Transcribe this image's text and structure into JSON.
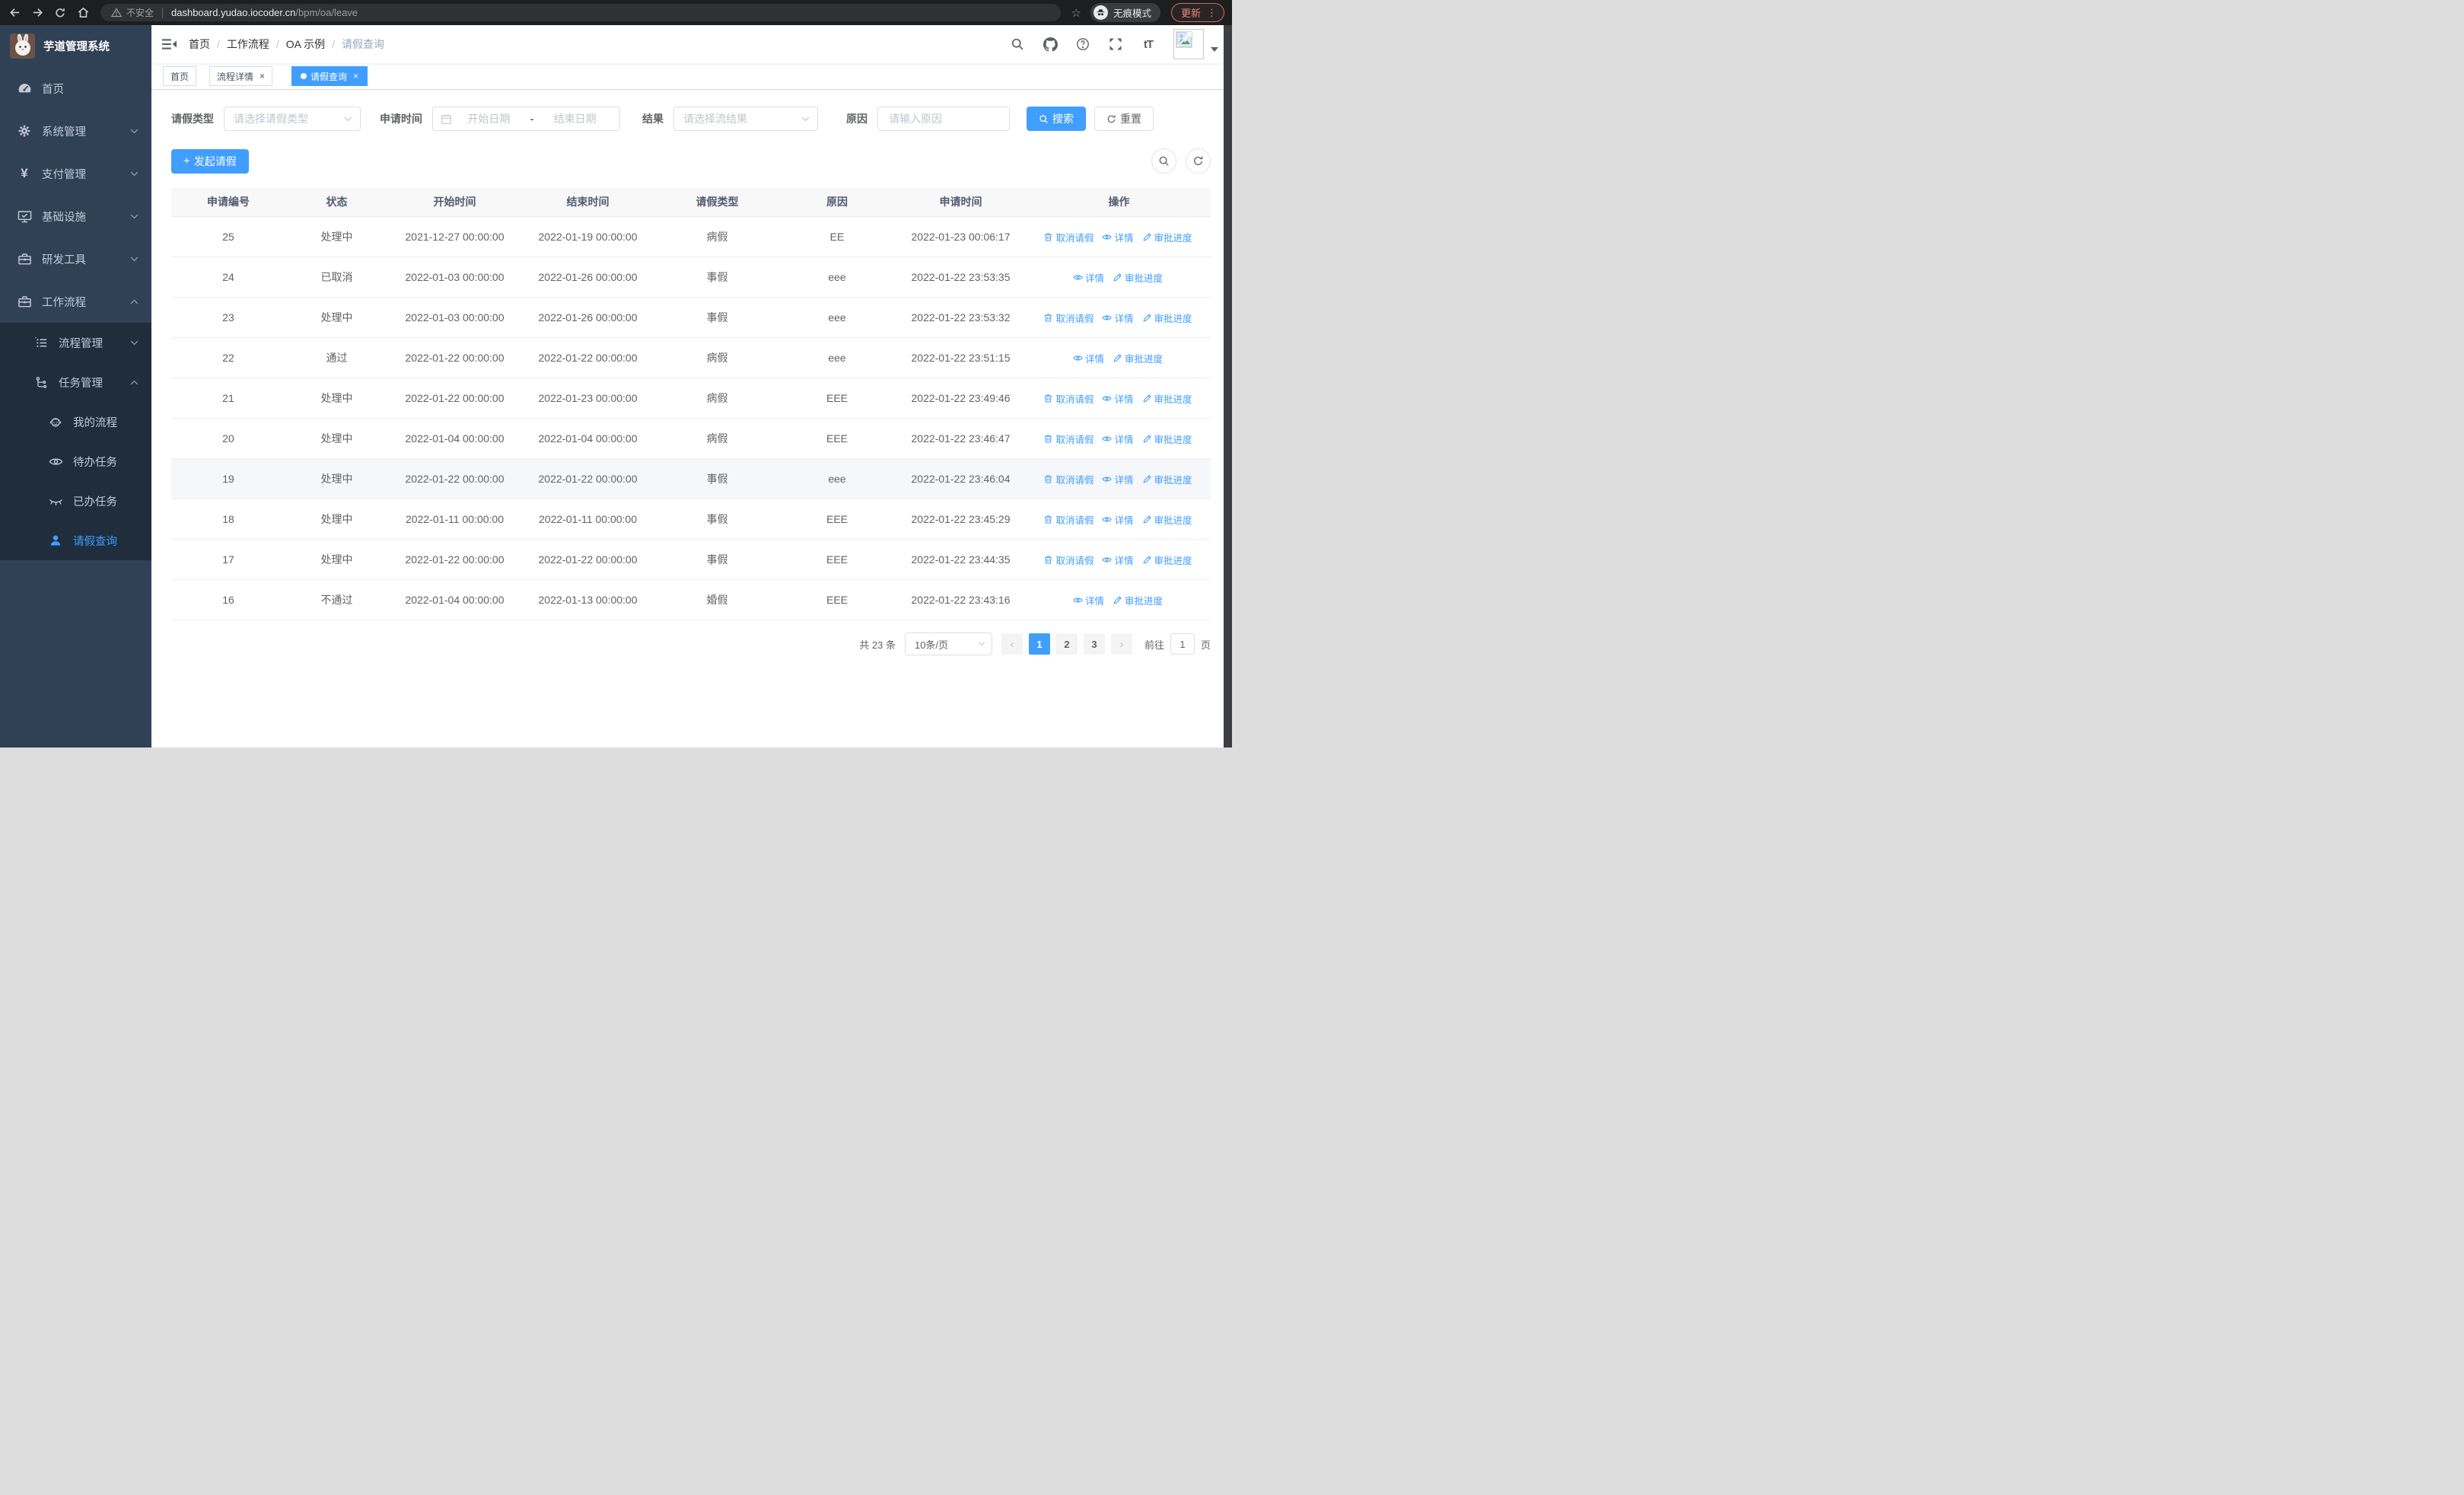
{
  "browser": {
    "security_label": "不安全",
    "url_domain": "dashboard.yudao.iocoder.cn",
    "url_path": "/bpm/oa/leave",
    "incognito_label": "无痕模式",
    "update_label": "更新",
    "nav_icons": [
      "back-icon",
      "forward-icon",
      "reload-icon",
      "home-icon"
    ]
  },
  "sidebar": {
    "logo_title": "芋道管理系统",
    "items": [
      {
        "label": "首页",
        "icon": "dashboard-icon"
      },
      {
        "label": "系统管理",
        "icon": "gear-icon",
        "state": "collapsed"
      },
      {
        "label": "支付管理",
        "icon": "yen-icon",
        "state": "collapsed"
      },
      {
        "label": "基础设施",
        "icon": "monitor-icon",
        "state": "collapsed"
      },
      {
        "label": "研发工具",
        "icon": "toolbox-icon",
        "state": "collapsed"
      },
      {
        "label": "工作流程",
        "icon": "briefcase-icon",
        "state": "expanded"
      }
    ],
    "workflow_children": [
      {
        "label": "流程管理",
        "icon": "list-icon",
        "state": "collapsed"
      },
      {
        "label": "任务管理",
        "icon": "tree-icon",
        "state": "expanded"
      }
    ],
    "task_children": [
      {
        "label": "我的流程",
        "icon": "robot-icon"
      },
      {
        "label": "待办任务",
        "icon": "eye-icon"
      },
      {
        "label": "已办任务",
        "icon": "eye-closed-icon"
      },
      {
        "label": "请假查询",
        "icon": "user-icon",
        "active": true
      }
    ]
  },
  "header": {
    "breadcrumb": [
      "首页",
      "工作流程",
      "OA 示例",
      "请假查询"
    ],
    "action_icons": [
      "search-icon",
      "github-icon",
      "help-icon",
      "fullscreen-icon",
      "font-size-icon"
    ],
    "font_icon_text": "tT"
  },
  "tabs": {
    "close_glyph": "×",
    "items": [
      {
        "label": "首页",
        "closable": false,
        "active": false
      },
      {
        "label": "流程详情",
        "closable": true,
        "active": false
      },
      {
        "label": "请假查询",
        "closable": true,
        "active": true
      }
    ]
  },
  "filters": {
    "leave_type": {
      "label": "请假类型",
      "placeholder": "请选择请假类型"
    },
    "apply_time": {
      "label": "申请时间",
      "start_placeholder": "开始日期",
      "separator": "-",
      "end_placeholder": "结束日期"
    },
    "result": {
      "label": "结果",
      "placeholder": "请选择流结果"
    },
    "reason": {
      "label": "原因",
      "placeholder": "请输入原因"
    },
    "search_label": "搜索",
    "reset_label": "重置"
  },
  "toolbar": {
    "create_label": "发起请假",
    "plus_glyph": "+"
  },
  "table": {
    "columns": [
      "申请编号",
      "状态",
      "开始时间",
      "结束时间",
      "请假类型",
      "原因",
      "申请时间",
      "操作"
    ],
    "action_labels": {
      "cancel": "取消请假",
      "detail": "详情",
      "progress": "审批进度"
    },
    "rows": [
      {
        "id": "25",
        "status": "处理中",
        "start": "2021-12-27 00:00:00",
        "end": "2022-01-19 00:00:00",
        "type": "病假",
        "reason": "EE",
        "applied": "2022-01-23 00:06:17",
        "cancellable": true,
        "highlight": false
      },
      {
        "id": "24",
        "status": "已取消",
        "start": "2022-01-03 00:00:00",
        "end": "2022-01-26 00:00:00",
        "type": "事假",
        "reason": "eee",
        "applied": "2022-01-22 23:53:35",
        "cancellable": false,
        "highlight": false
      },
      {
        "id": "23",
        "status": "处理中",
        "start": "2022-01-03 00:00:00",
        "end": "2022-01-26 00:00:00",
        "type": "事假",
        "reason": "eee",
        "applied": "2022-01-22 23:53:32",
        "cancellable": true,
        "highlight": false
      },
      {
        "id": "22",
        "status": "通过",
        "start": "2022-01-22 00:00:00",
        "end": "2022-01-22 00:00:00",
        "type": "病假",
        "reason": "eee",
        "applied": "2022-01-22 23:51:15",
        "cancellable": false,
        "highlight": false
      },
      {
        "id": "21",
        "status": "处理中",
        "start": "2022-01-22 00:00:00",
        "end": "2022-01-23 00:00:00",
        "type": "病假",
        "reason": "EEE",
        "applied": "2022-01-22 23:49:46",
        "cancellable": true,
        "highlight": false
      },
      {
        "id": "20",
        "status": "处理中",
        "start": "2022-01-04 00:00:00",
        "end": "2022-01-04 00:00:00",
        "type": "病假",
        "reason": "EEE",
        "applied": "2022-01-22 23:46:47",
        "cancellable": true,
        "highlight": false
      },
      {
        "id": "19",
        "status": "处理中",
        "start": "2022-01-22 00:00:00",
        "end": "2022-01-22 00:00:00",
        "type": "事假",
        "reason": "eee",
        "applied": "2022-01-22 23:46:04",
        "cancellable": true,
        "highlight": true
      },
      {
        "id": "18",
        "status": "处理中",
        "start": "2022-01-11 00:00:00",
        "end": "2022-01-11 00:00:00",
        "type": "事假",
        "reason": "EEE",
        "applied": "2022-01-22 23:45:29",
        "cancellable": true,
        "highlight": false
      },
      {
        "id": "17",
        "status": "处理中",
        "start": "2022-01-22 00:00:00",
        "end": "2022-01-22 00:00:00",
        "type": "事假",
        "reason": "EEE",
        "applied": "2022-01-22 23:44:35",
        "cancellable": true,
        "highlight": false
      },
      {
        "id": "16",
        "status": "不通过",
        "start": "2022-01-04 00:00:00",
        "end": "2022-01-13 00:00:00",
        "type": "婚假",
        "reason": "EEE",
        "applied": "2022-01-22 23:43:16",
        "cancellable": false,
        "highlight": false
      }
    ]
  },
  "pagination": {
    "total_label": "共 23 条",
    "page_size": "10条/页",
    "prev_glyph": "‹",
    "next_glyph": "›",
    "pages": [
      "1",
      "2",
      "3"
    ],
    "active_page": "1",
    "goto_label": "前往",
    "goto_value": "1",
    "unit_label": "页"
  },
  "colors": {
    "accent": "#409eff",
    "sidebar_bg": "#304156",
    "submenu_bg": "#1f2d3d",
    "sidebar_text": "#bfcbd9",
    "table_header_bg": "#f8f8f9",
    "border": "#ebeef5",
    "update_badge": "#ee8779"
  }
}
